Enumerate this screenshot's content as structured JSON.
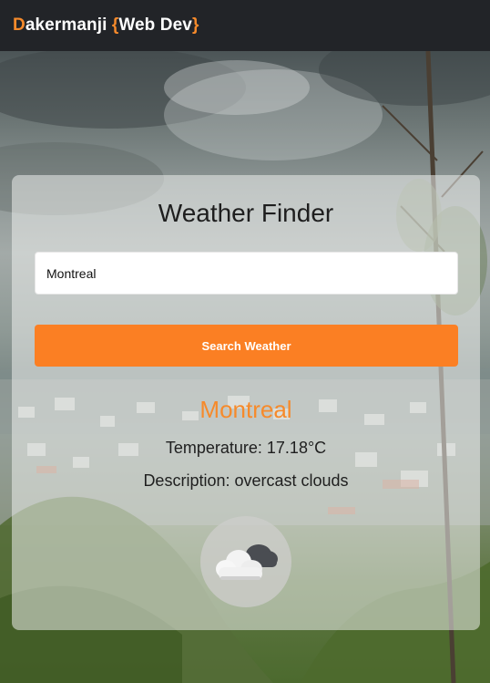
{
  "header": {
    "brand_initial": "D",
    "brand_rest": "akermanji ",
    "brand_tag_open": "{",
    "brand_tag_text": "Web Dev",
    "brand_tag_close": "}"
  },
  "card": {
    "title": "Weather Finder",
    "city_input_value": "Montreal",
    "search_button_label": "Search Weather"
  },
  "result": {
    "city": "Montreal",
    "temperature_label": "Temperature:",
    "temperature_value": "17.18°C",
    "description_label": "Description:",
    "description_value": "overcast clouds",
    "icon": "overcast-clouds-icon"
  },
  "colors": {
    "accent": "#f68a2b",
    "button": "#fb7f23",
    "header_bg": "#222428"
  }
}
